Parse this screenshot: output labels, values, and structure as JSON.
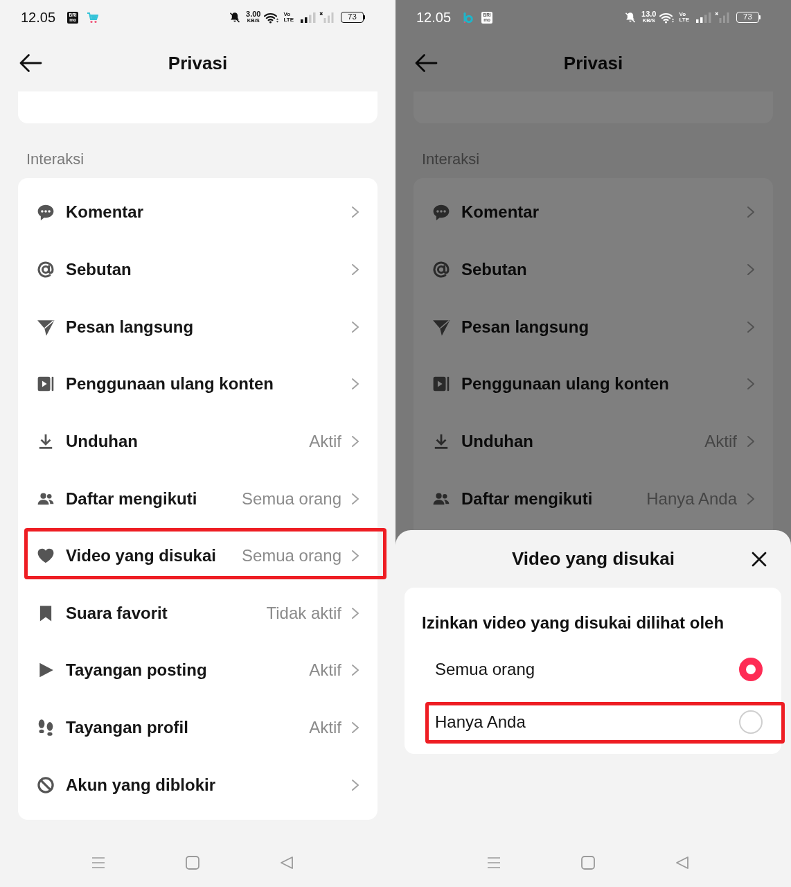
{
  "screens": [
    {
      "dimmed": false,
      "status_bar": {
        "time": "12.05",
        "notification_icons": [
          {
            "kind": "bri",
            "lines": [
              "BRI",
              "mo"
            ]
          },
          {
            "kind": "cart"
          }
        ],
        "network_speed": [
          "3.00",
          "KB/S"
        ],
        "volte": [
          "Vo",
          "LTE"
        ],
        "battery": "73"
      },
      "header": {
        "title": "Privasi"
      },
      "section_label": "Interaksi",
      "items": [
        {
          "kind": "comment",
          "label": "Komentar",
          "highlighted": false
        },
        {
          "kind": "mention",
          "label": "Sebutan",
          "highlighted": false
        },
        {
          "kind": "message",
          "label": "Pesan langsung",
          "highlighted": false
        },
        {
          "kind": "reuse",
          "label": "Penggunaan ulang konten",
          "highlighted": false
        },
        {
          "kind": "download",
          "label": "Unduhan",
          "value": "Aktif",
          "highlighted": false
        },
        {
          "kind": "following",
          "label": "Daftar mengikuti",
          "value": "Semua orang",
          "highlighted": false
        },
        {
          "kind": "liked",
          "label": "Video yang disukai",
          "value": "Semua orang",
          "highlighted": true
        },
        {
          "kind": "sound",
          "label": "Suara favorit",
          "value": "Tidak aktif",
          "highlighted": false
        },
        {
          "kind": "post-views",
          "label": "Tayangan posting",
          "value": "Aktif",
          "highlighted": false
        },
        {
          "kind": "profile-views",
          "label": "Tayangan profil",
          "value": "Aktif",
          "highlighted": false
        },
        {
          "kind": "blocked",
          "label": "Akun yang diblokir",
          "highlighted": false
        }
      ]
    },
    {
      "dimmed": true,
      "status_bar": {
        "time": "12.05",
        "notification_icons": [
          {
            "kind": "b-app"
          },
          {
            "kind": "bri",
            "lines": [
              "BRI",
              "mo"
            ]
          }
        ],
        "network_speed": [
          "13.0",
          "KB/S"
        ],
        "volte": [
          "Vo",
          "LTE"
        ],
        "battery": "73"
      },
      "header": {
        "title": "Privasi"
      },
      "section_label": "Interaksi",
      "items": [
        {
          "kind": "comment",
          "label": "Komentar",
          "highlighted": false
        },
        {
          "kind": "mention",
          "label": "Sebutan",
          "highlighted": false
        },
        {
          "kind": "message",
          "label": "Pesan langsung",
          "highlighted": false
        },
        {
          "kind": "reuse",
          "label": "Penggunaan ulang konten",
          "highlighted": false
        },
        {
          "kind": "download",
          "label": "Unduhan",
          "value": "Aktif",
          "highlighted": false
        },
        {
          "kind": "following",
          "label": "Daftar mengikuti",
          "value": "Hanya Anda",
          "highlighted": false
        }
      ],
      "sheet": {
        "title": "Video yang disukai",
        "prompt": "Izinkan video yang disukai dilihat oleh",
        "options": [
          {
            "label": "Semua orang",
            "selected": true,
            "highlighted": false
          },
          {
            "label": "Hanya Anda",
            "selected": false,
            "highlighted": true
          }
        ]
      }
    }
  ]
}
